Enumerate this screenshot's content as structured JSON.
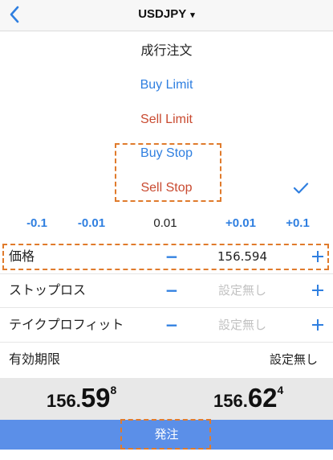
{
  "header": {
    "symbol": "USDJPY",
    "caret": "▾"
  },
  "order_types": [
    {
      "label": "成行注文",
      "color": "black"
    },
    {
      "label": "Buy Limit",
      "color": "blue"
    },
    {
      "label": "Sell Limit",
      "color": "red"
    },
    {
      "label": "Buy Stop",
      "color": "blue"
    },
    {
      "label": "Sell Stop",
      "color": "red",
      "selected": true
    }
  ],
  "stepper": [
    "-0.1",
    "-0.01",
    "0.01",
    "+0.01",
    "+0.1"
  ],
  "price": {
    "label": "価格",
    "minus": "−",
    "value": "156.594"
  },
  "stop_loss": {
    "label": "ストップロス",
    "minus": "−",
    "placeholder": "設定無し"
  },
  "take_profit": {
    "label": "テイクプロフィット",
    "minus": "−",
    "placeholder": "設定無し"
  },
  "expiry": {
    "label": "有効期限",
    "value": "設定無し"
  },
  "quotes": {
    "bid": {
      "prefix": "156.",
      "big": "59",
      "sup": "8"
    },
    "ask": {
      "prefix": "156.",
      "big": "62",
      "sup": "4"
    }
  },
  "submit_label": "発注",
  "colors": {
    "accent_blue": "#2f7fe0",
    "red": "#c94a30",
    "highlight_orange": "#e07b2c",
    "submit_bar": "#5b8fe8",
    "quote_band": "#e8e8e8"
  }
}
